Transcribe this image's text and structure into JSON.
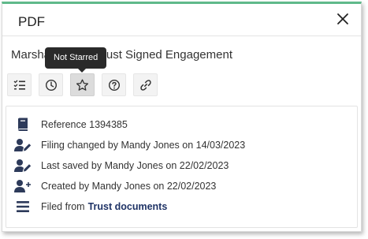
{
  "panel": {
    "title": "PDF",
    "document_title": "Marshall Estate Trust Signed Engagement"
  },
  "toolbar": {
    "buttons": [
      {
        "name": "checklist-button",
        "icon": "checklist-icon"
      },
      {
        "name": "history-button",
        "icon": "clock-icon"
      },
      {
        "name": "star-button",
        "icon": "star-icon",
        "active": true
      },
      {
        "name": "help-button",
        "icon": "question-icon"
      },
      {
        "name": "link-button",
        "icon": "link-icon"
      }
    ],
    "tooltip": "Not Starred"
  },
  "details": {
    "reference": "Reference 1394385",
    "filing_changed": "Filing changed by Mandy Jones on 14/03/2023",
    "last_saved": "Last saved by Mandy Jones on 22/02/2023",
    "created": "Created by Mandy Jones on 22/02/2023",
    "filed_from_prefix": "Filed from",
    "filed_from_location": "Trust documents"
  },
  "colors": {
    "accent_top": "#5fb98a",
    "icon_dark": "#2d3a5a",
    "location_text": "#1f3366",
    "tooltip_bg": "#2a2a2a"
  }
}
